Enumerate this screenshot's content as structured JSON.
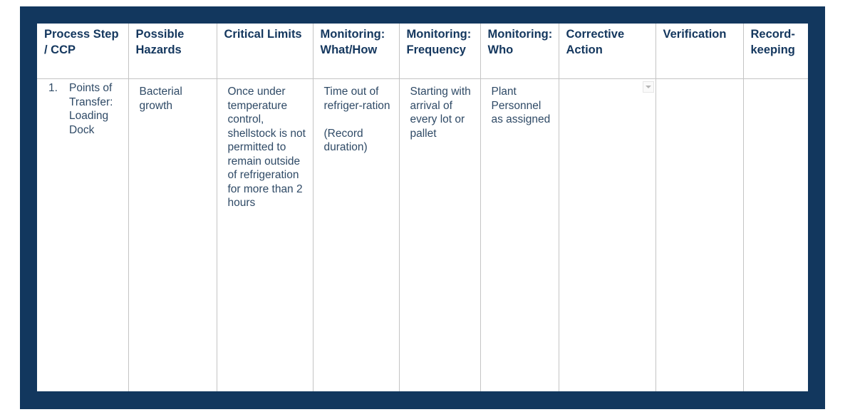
{
  "colors": {
    "frame": "#12375e",
    "header_text": "#14375e",
    "body_text": "#2f4a66",
    "grid": "#c4c4c4"
  },
  "table": {
    "headers": [
      "Process Step / CCP",
      "Possible Hazards",
      "Critical Limits",
      "Monitoring: What/How",
      "Monitoring: Frequency",
      "Monitoring: Who",
      "Corrective Action",
      "Verification",
      "Record-keeping"
    ],
    "rows": [
      {
        "number": "1.",
        "process_step": "Points of Transfer: Loading Dock",
        "possible_hazards": "Bacterial growth",
        "critical_limits": "Once under temperature control, shellstock is not\npermitted to remain outside of refrigeration for more than 2 hours",
        "monitoring_what_how": "Time out of refriger-ration\n\n(Record duration)",
        "monitoring_frequency": "Starting with arrival of every lot or pallet",
        "monitoring_who": "Plant Personnel as assigned",
        "corrective_action": "",
        "corrective_action_dropdown_icon": "chevron-down-icon",
        "verification": "",
        "recordkeeping": ""
      }
    ]
  }
}
